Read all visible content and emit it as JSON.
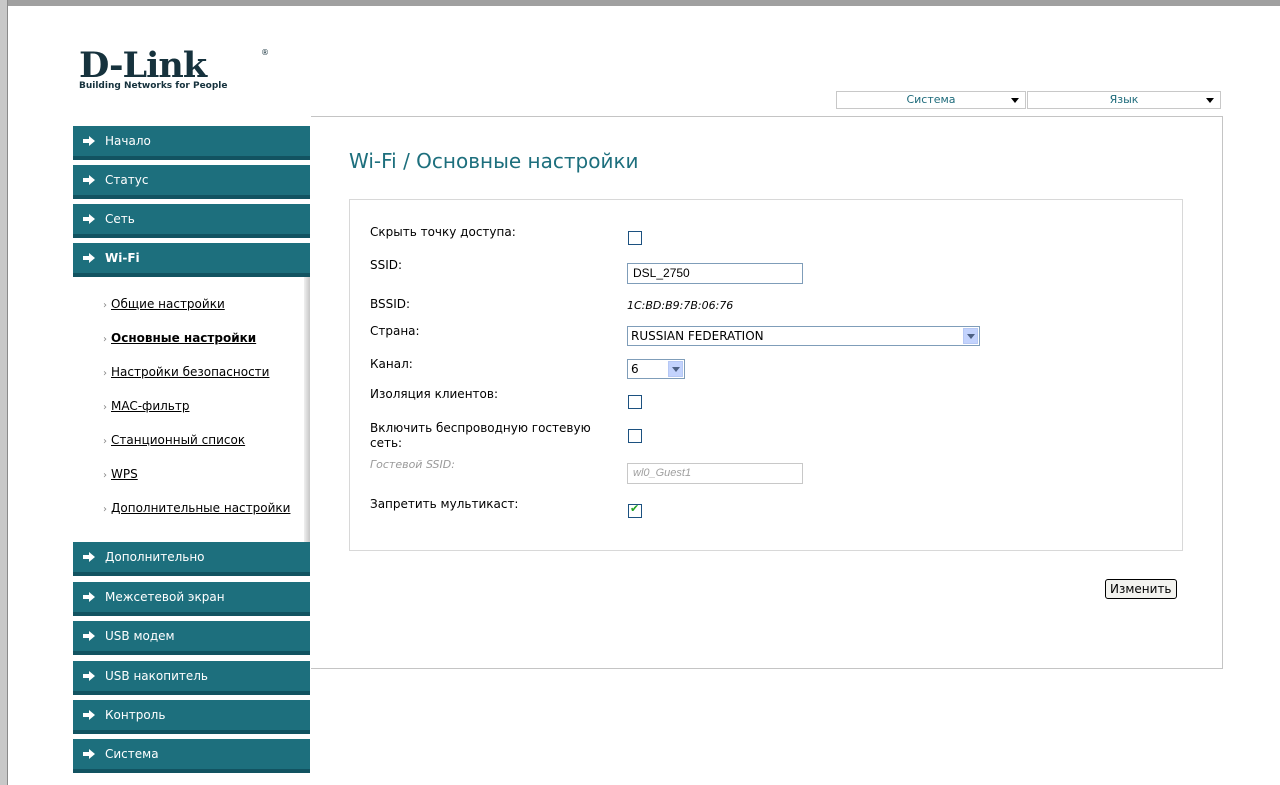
{
  "logo": {
    "brand": "D-Link",
    "trademark": "®",
    "tagline": "Building Networks for People"
  },
  "top_menu": {
    "system": "Система",
    "language": "Язык"
  },
  "sidebar": {
    "sections_top": [
      {
        "label": "Начало"
      },
      {
        "label": "Статус"
      },
      {
        "label": "Сеть"
      },
      {
        "label": "Wi-Fi",
        "active": true
      }
    ],
    "wifi_items": [
      {
        "label": "Общие настройки"
      },
      {
        "label": "Основные настройки",
        "active": true
      },
      {
        "label": "Настройки безопасности"
      },
      {
        "label": "MAC-фильтр"
      },
      {
        "label": "Станционный список"
      },
      {
        "label": "WPS"
      },
      {
        "label": "Дополнительные настройки"
      }
    ],
    "sections_bottom": [
      {
        "label": "Дополнительно"
      },
      {
        "label": "Межсетевой экран"
      },
      {
        "label": "USB модем"
      },
      {
        "label": "USB накопитель"
      },
      {
        "label": "Контроль"
      },
      {
        "label": "Система"
      }
    ]
  },
  "page": {
    "title": "Wi-Fi /  Основные настройки",
    "fields": {
      "hide_ap_label": "Скрыть точку доступа:",
      "hide_ap_checked": false,
      "ssid_label": "SSID:",
      "ssid_value": "DSL_2750",
      "bssid_label": "BSSID:",
      "bssid_value": "1C:BD:B9:7B:06:76",
      "country_label": "Страна:",
      "country_value": "RUSSIAN FEDERATION",
      "channel_label": "Канал:",
      "channel_value": "6",
      "isolation_label": "Изоляция клиентов:",
      "isolation_checked": false,
      "guest_label_line1": "Включить беспроводную гостевую",
      "guest_label_line2": "сеть:",
      "guest_checked": false,
      "guest_ssid_label": "Гостевой SSID:",
      "guest_ssid_value": "wl0_Guest1",
      "multicast_label": "Запретить мультикаст:",
      "multicast_checked": true
    },
    "apply_button": "Изменить"
  }
}
